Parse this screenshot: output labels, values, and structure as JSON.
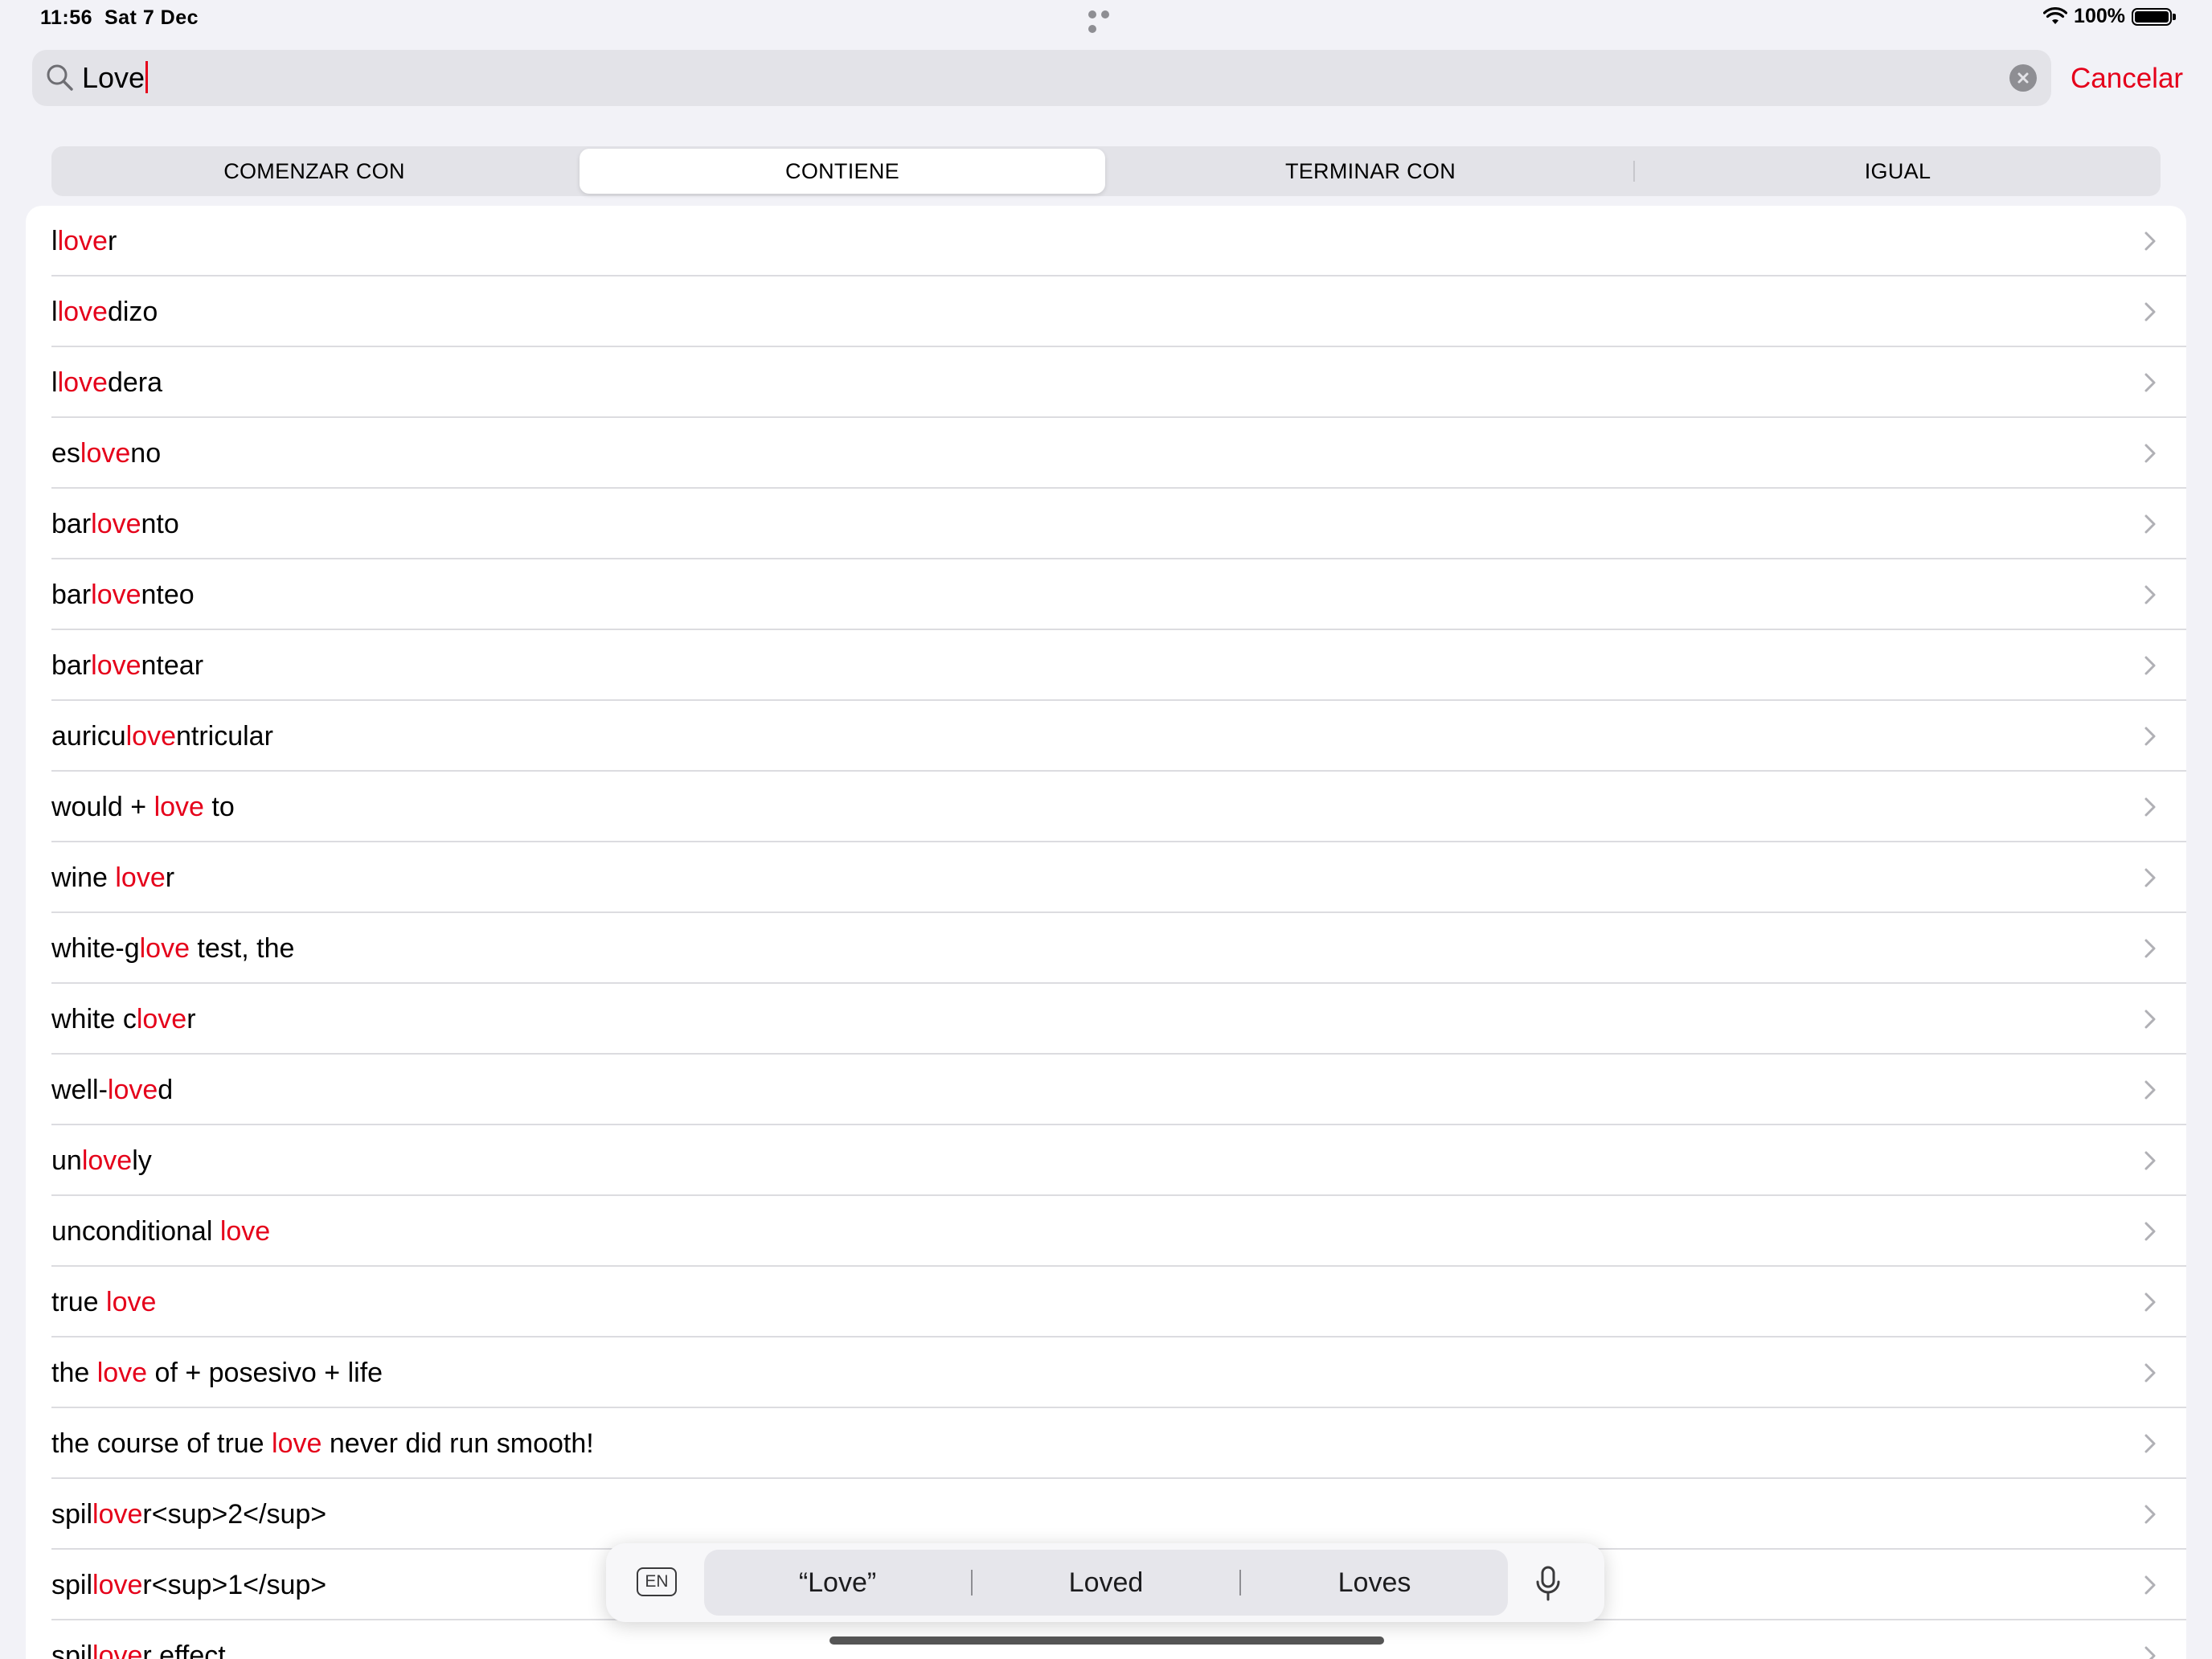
{
  "status_bar": {
    "time": "11:56",
    "date": "Sat 7 Dec",
    "battery": "100%",
    "icons": [
      "wifi-icon",
      "battery-icon"
    ]
  },
  "search": {
    "query": "Love",
    "cancel_label": "Cancelar"
  },
  "segments": [
    {
      "label": "COMENZAR CON",
      "active": false
    },
    {
      "label": "CONTIENE",
      "active": true
    },
    {
      "label": "TERMINAR CON",
      "active": false
    },
    {
      "label": "IGUAL",
      "active": false
    }
  ],
  "results": [
    {
      "pre": "l",
      "hl": "love",
      "post": "r"
    },
    {
      "pre": "l",
      "hl": "love",
      "post": "dizo"
    },
    {
      "pre": "l",
      "hl": "love",
      "post": "dera"
    },
    {
      "pre": "es",
      "hl": "love",
      "post": "no"
    },
    {
      "pre": "bar",
      "hl": "love",
      "post": "nto"
    },
    {
      "pre": "bar",
      "hl": "love",
      "post": "nteo"
    },
    {
      "pre": "bar",
      "hl": "love",
      "post": "ntear"
    },
    {
      "pre": "auricu",
      "hl": "love",
      "post": "ntricular"
    },
    {
      "pre": "would + ",
      "hl": "love",
      "post": " to"
    },
    {
      "pre": "wine ",
      "hl": "love",
      "post": "r"
    },
    {
      "pre": "white-g",
      "hl": "love",
      "post": " test, the"
    },
    {
      "pre": "white c",
      "hl": "love",
      "post": "r"
    },
    {
      "pre": "well-",
      "hl": "love",
      "post": "d"
    },
    {
      "pre": "un",
      "hl": "love",
      "post": "ly"
    },
    {
      "pre": "unconditional ",
      "hl": "love",
      "post": ""
    },
    {
      "pre": "true ",
      "hl": "love",
      "post": ""
    },
    {
      "pre": "the ",
      "hl": "love",
      "post": " of + posesivo + life"
    },
    {
      "pre": "the course of true ",
      "hl": "love",
      "post": " never did run smooth!"
    },
    {
      "pre": "spil",
      "hl": "love",
      "post": "r<sup>2</sup>"
    },
    {
      "pre": "spil",
      "hl": "love",
      "post": "r<sup>1</sup>"
    },
    {
      "pre": "spil",
      "hl": "love",
      "post": "r effect"
    }
  ],
  "keyboard_bar": {
    "language": "EN",
    "suggestions": [
      "“Love”",
      "Loved",
      "Loves"
    ]
  },
  "colors": {
    "accent": "#e5001a",
    "background": "#f2f2f7"
  }
}
